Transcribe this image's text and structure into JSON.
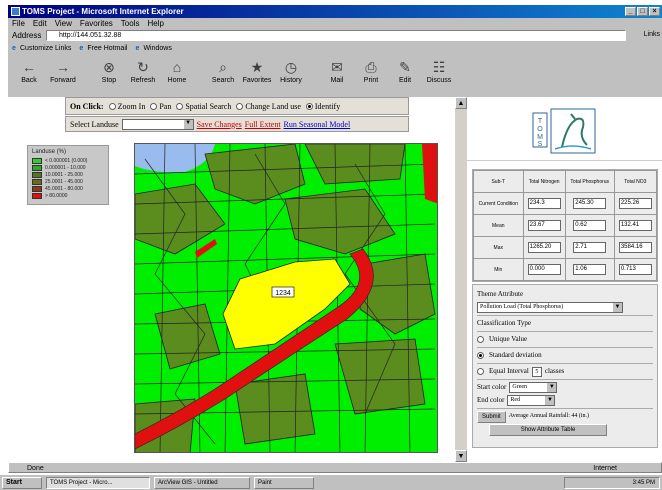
{
  "window": {
    "title": "TOMS Project - Microsoft Internet Explorer",
    "controls": [
      "_",
      "□",
      "×"
    ]
  },
  "menu": [
    "File",
    "Edit",
    "View",
    "Favorites",
    "Tools",
    "Help"
  ],
  "address": {
    "label": "Address",
    "value": "http://144.051.32.88",
    "go": "Links"
  },
  "links": [
    "Customize Links",
    "Free Hotmail",
    "Windows"
  ],
  "toolbar": [
    "Back",
    "Forward",
    "Stop",
    "Refresh",
    "Home",
    "Search",
    "Favorites",
    "History",
    "Mail",
    "Print",
    "Edit",
    "Discuss"
  ],
  "map_controls": {
    "on_click_label": "On Click:",
    "options": [
      {
        "label": "Zoom In",
        "checked": false
      },
      {
        "label": "Pan",
        "checked": false
      },
      {
        "label": "Spatial Search",
        "checked": false
      },
      {
        "label": "Change Land use",
        "checked": false
      },
      {
        "label": "Identify",
        "checked": true
      }
    ],
    "select_label": "Select Landuse",
    "link_save": "Save Changes",
    "link_default": "Full Extent",
    "link_run": "Run Seasonal Model"
  },
  "legend": {
    "title": "Landuse (%)",
    "items": [
      {
        "label": "< 0.000001 (0.000)",
        "color": "#33cc33"
      },
      {
        "label": "0.000001 - 10.000",
        "color": "#2faa2f"
      },
      {
        "label": "10.0001 - 25.000",
        "color": "#4f7a1f"
      },
      {
        "label": "25.0001 - 45.000",
        "color": "#6b6b1e"
      },
      {
        "label": "45.0001 - 80.000",
        "color": "#8a3a1a"
      },
      {
        "label": "> 80.0000",
        "color": "#e01010"
      }
    ]
  },
  "map": {
    "selected_label": "1234",
    "colors": {
      "water": "#99bbee",
      "light_green": "#00ee00",
      "olive": "#5a8c1e",
      "red": "#e01010",
      "yellow": "#ffff00",
      "border": "#222222"
    }
  },
  "stats": {
    "headers": [
      "Sub-T",
      "Total Nitrogen",
      "Total Phosphorus",
      "Total NO3"
    ],
    "rows": [
      {
        "label": "Current Condition",
        "values": [
          "234.3",
          "245.30",
          "225.26"
        ]
      },
      {
        "label": "Mean",
        "values": [
          "23.67",
          "0.62",
          "132.41"
        ]
      },
      {
        "label": "Max",
        "values": [
          "1265.20",
          "2.71",
          "3584.16"
        ]
      },
      {
        "label": "Min",
        "values": [
          "0.000",
          "1.06",
          "0.713"
        ]
      }
    ]
  },
  "theme": {
    "title": "Theme Attribute",
    "attribute_value": "Pollution Load (Total Phosphorus)",
    "classification_label": "Classification Type",
    "options": [
      {
        "label": "Unique Value",
        "checked": false
      },
      {
        "label": "Standard deviation",
        "checked": true
      },
      {
        "label": "Equal Interval",
        "checked": false
      }
    ],
    "classes_label": "classes",
    "classes_value": "5",
    "start_color_label": "Start color",
    "start_color_value": "Green",
    "end_color_label": "End color",
    "end_color_value": "Red",
    "submit_label": "Submit",
    "avg_text": "Average Annual Rainfall: 44 (in.)",
    "show_table_label": "Show Attribute Table"
  },
  "status": {
    "text": "Done",
    "zone": "Internet"
  },
  "taskbar": {
    "start": "Start",
    "tasks": [
      "TOMS Project - Micro...",
      "ArcView GIS - Untitled",
      "Paint"
    ],
    "clock": "3:45 PM"
  }
}
